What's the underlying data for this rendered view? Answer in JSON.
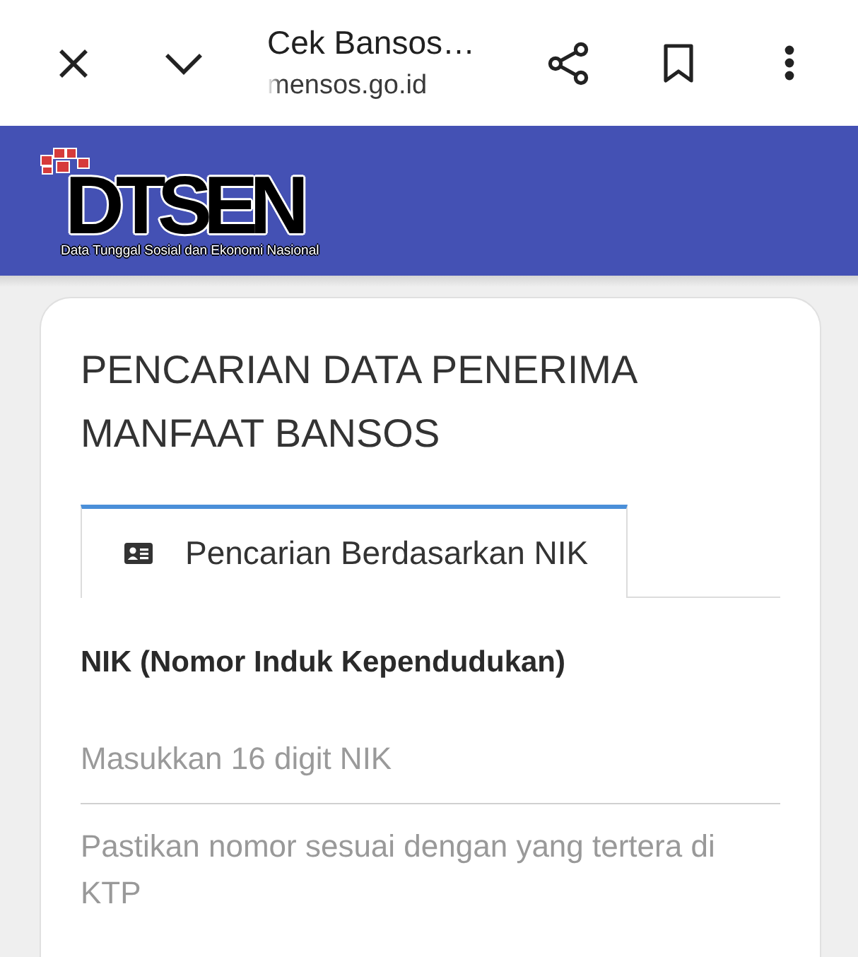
{
  "browser_bar": {
    "title": "Cek Bansos…",
    "url": "mensos.go.id"
  },
  "header": {
    "logo_text": "DTSEN",
    "logo_subtitle": "Data Tunggal Sosial dan Ekonomi Nasional"
  },
  "card": {
    "title": "PENCARIAN DATA PENERIMA MANFAAT BANSOS",
    "tabs": [
      {
        "label": "Pencarian Berdasarkan NIK",
        "selected": true
      }
    ],
    "field": {
      "label": "NIK (Nomor Induk Kependudukan)",
      "placeholder": "Masukkan 16 digit NIK",
      "help": "Pastikan nomor sesuai dengan yang tertera di KTP"
    }
  }
}
